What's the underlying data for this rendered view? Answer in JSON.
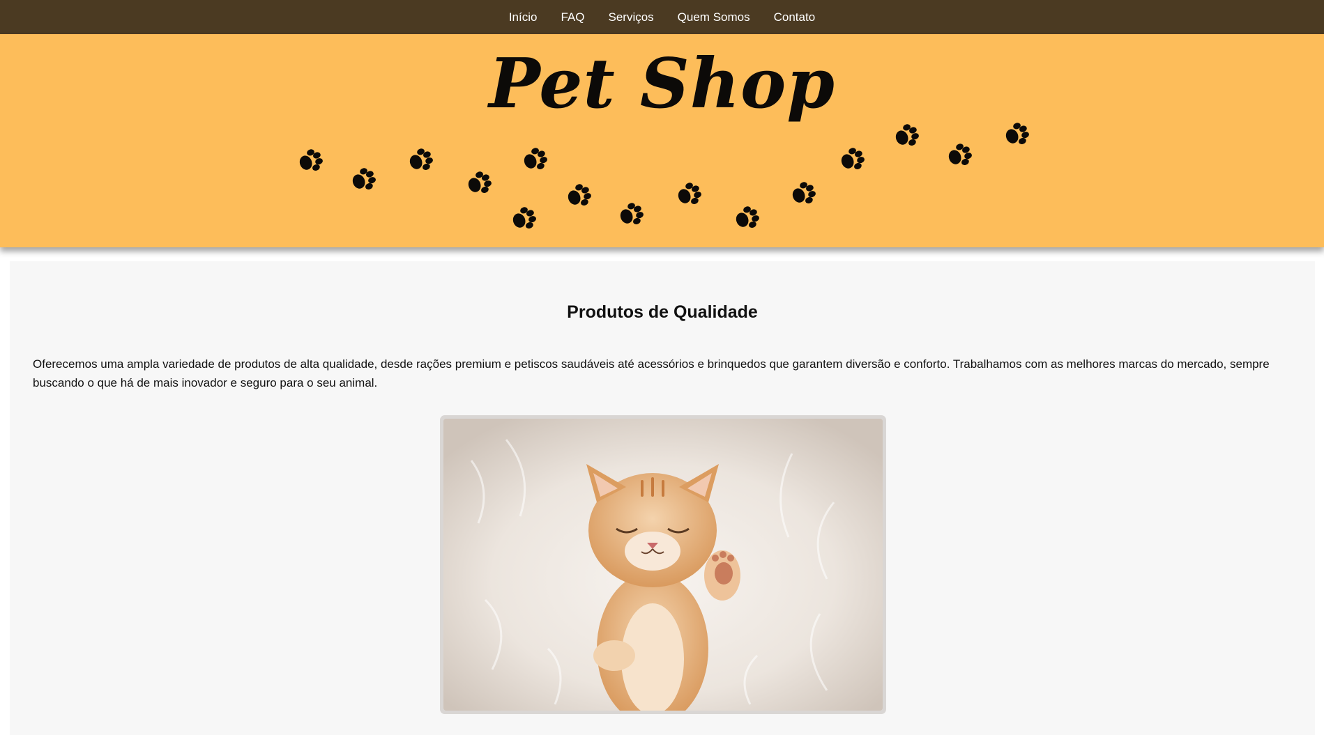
{
  "nav": {
    "items": [
      {
        "label": "Início"
      },
      {
        "label": "FAQ"
      },
      {
        "label": "Serviços"
      },
      {
        "label": "Quem Somos"
      },
      {
        "label": "Contato"
      }
    ]
  },
  "hero": {
    "title": "Pet Shop",
    "background_color": "#fdbd5a",
    "decoration": "paw-print-trail"
  },
  "section": {
    "heading": "Produtos de Qualidade",
    "paragraph": "Oferecemos uma ampla variedade de produtos de alta qualidade, desde rações premium e petiscos saudáveis até acessórios e brinquedos que garantem diversão e conforto. Trabalhamos com as melhores marcas do mercado, sempre buscando o que há de mais inovador e seguro para o seu animal.",
    "image": "sleeping-kitten-photo"
  },
  "colors": {
    "nav_bg": "#4b3a22",
    "hero_bg": "#fdbd5a",
    "content_bg": "#f7f7f7"
  }
}
